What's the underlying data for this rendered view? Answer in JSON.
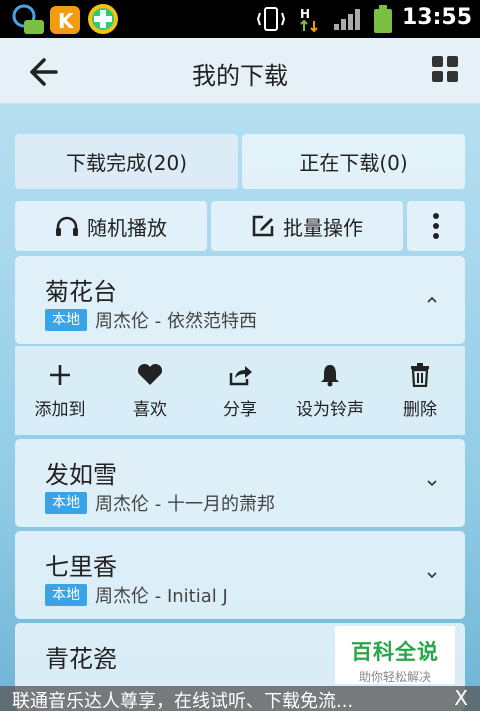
{
  "status_bar": {
    "time": "13:55"
  },
  "header": {
    "title": "我的下载"
  },
  "tabs": [
    {
      "label": "下载完成(20)",
      "active": true
    },
    {
      "label": "正在下载(0)",
      "active": false
    }
  ],
  "actions": {
    "random_play": "随机播放",
    "batch_op": "批量操作"
  },
  "songs": [
    {
      "title": "菊花台",
      "badge": "本地",
      "meta": "周杰伦 - 依然范特西",
      "expanded": true
    },
    {
      "title": "发如雪",
      "badge": "本地",
      "meta": "周杰伦 - 十一月的萧邦",
      "expanded": false
    },
    {
      "title": "七里香",
      "badge": "本地",
      "meta": "周杰伦 - Initial J",
      "expanded": false
    },
    {
      "title": "青花瓷",
      "badge": "",
      "meta": "",
      "expanded": false
    }
  ],
  "song_tools": [
    {
      "label": "添加到",
      "icon": "plus-icon"
    },
    {
      "label": "喜欢",
      "icon": "heart-icon"
    },
    {
      "label": "分享",
      "icon": "share-icon"
    },
    {
      "label": "设为铃声",
      "icon": "bell-icon"
    },
    {
      "label": "删除",
      "icon": "trash-icon"
    }
  ],
  "watermark": {
    "line1": "百科全说",
    "line2": "助你轻松解决"
  },
  "banner": {
    "text": "联通音乐达人尊享，在线试听、下载免流...",
    "close": "X"
  },
  "colors": {
    "accent": "#3aa3e6",
    "logo_green": "#2aa64a"
  }
}
